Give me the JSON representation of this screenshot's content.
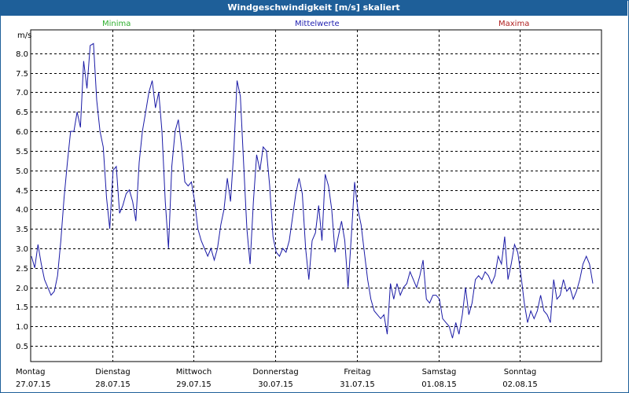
{
  "window": {
    "title": "Windgeschwindigkeit [m/s] skaliert"
  },
  "legend": {
    "min": "Minima",
    "mean": "Mittelwerte",
    "max": "Maxima"
  },
  "colors": {
    "titlebar": "#1e5f99",
    "line": "#1a1aa6",
    "minima": "#2fb02f",
    "mean": "#1f1fb0",
    "maxima": "#b02020"
  },
  "chart_data": {
    "type": "line",
    "title": "Windgeschwindigkeit [m/s] skaliert",
    "ylabel": "m/s",
    "ylim": [
      0.1,
      8.6
    ],
    "yticks": [
      "0.5",
      "1.0",
      "1.5",
      "2.0",
      "2.5",
      "3.0",
      "3.5",
      "4.0",
      "4.5",
      "5.0",
      "5.5",
      "6.0",
      "6.5",
      "7.0",
      "7.5",
      "8.0"
    ],
    "days": [
      {
        "name": "Montag",
        "date": "27.07.15"
      },
      {
        "name": "Dienstag",
        "date": "28.07.15"
      },
      {
        "name": "Mittwoch",
        "date": "29.07.15"
      },
      {
        "name": "Donnerstag",
        "date": "30.07.15"
      },
      {
        "name": "Freitag",
        "date": "31.07.15"
      },
      {
        "name": "Samstag",
        "date": "01.08.15"
      },
      {
        "name": "Sonntag",
        "date": "02.08.15"
      }
    ],
    "grid": true,
    "series": [
      {
        "values": [
          2.8,
          2.5,
          3.1,
          2.6,
          2.2,
          2.0,
          1.8,
          1.9,
          2.3,
          3.2,
          4.3,
          5.2,
          6.0,
          6.0,
          6.5,
          6.1,
          7.8,
          7.1,
          8.2,
          8.25,
          6.8,
          6.0,
          5.6,
          4.3,
          3.5,
          5.0,
          5.1,
          3.9,
          4.1,
          4.4,
          4.5,
          4.2,
          3.7,
          5.2,
          6.0,
          6.5,
          7.0,
          7.3,
          6.6,
          7.0,
          6.0,
          4.2,
          3.0,
          5.1,
          6.0,
          6.3,
          5.6,
          4.7,
          4.6,
          4.7,
          4.2,
          3.5,
          3.2,
          3.0,
          2.8,
          3.0,
          2.7,
          3.0,
          3.6,
          4.0,
          4.8,
          4.2,
          5.5,
          7.3,
          6.9,
          5.2,
          3.5,
          2.6,
          4.2,
          5.4,
          5.0,
          5.6,
          5.5,
          4.6,
          3.3,
          2.9,
          2.8,
          3.0,
          2.9,
          3.2,
          3.8,
          4.4,
          4.8,
          4.4,
          3.0,
          2.2,
          3.2,
          3.4,
          4.1,
          3.2,
          4.9,
          4.6,
          4.0,
          2.9,
          3.3,
          3.7,
          3.2,
          2.0,
          3.3,
          4.7,
          4.0,
          3.6,
          2.9,
          2.2,
          1.7,
          1.4,
          1.3,
          1.2,
          1.3,
          0.8,
          2.1,
          1.7,
          2.1,
          1.8,
          2.0,
          2.1,
          2.4,
          2.2,
          2.0,
          2.3,
          2.7,
          1.7,
          1.6,
          1.8,
          1.8,
          1.7,
          1.2,
          1.1,
          1.0,
          0.7,
          1.1,
          0.8,
          1.3,
          2.0,
          1.3,
          1.6,
          2.2,
          2.3,
          2.2,
          2.4,
          2.3,
          2.1,
          2.3,
          2.8,
          2.6,
          3.3,
          2.2,
          2.6,
          3.1,
          2.9,
          2.3,
          1.6,
          1.1,
          1.4,
          1.2,
          1.4,
          1.8,
          1.4,
          1.3,
          1.1,
          2.2,
          1.7,
          1.8,
          2.2,
          1.9,
          2.0,
          1.7,
          1.9,
          2.2,
          2.6,
          2.8,
          2.6,
          2.1
        ]
      }
    ]
  }
}
